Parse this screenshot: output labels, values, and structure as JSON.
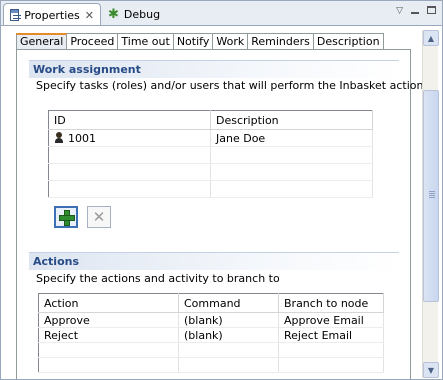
{
  "views": {
    "tabs": [
      {
        "label": "Properties",
        "active": true
      },
      {
        "label": "Debug",
        "active": false
      }
    ]
  },
  "page_tabs": [
    "General",
    "Proceed",
    "Time out",
    "Notify",
    "Work",
    "Reminders",
    "Description"
  ],
  "selected_tab": "General",
  "work_assignment": {
    "title": "Work assignment",
    "description": "Specify tasks (roles) and/or users that will perform the Inbasket action",
    "columns": [
      "ID",
      "Description"
    ],
    "rows": [
      {
        "id": "1001",
        "description": "Jane Doe",
        "icon": "user-icon"
      }
    ]
  },
  "actions": {
    "title": "Actions",
    "description": "Specify the actions and activity to branch to",
    "columns": [
      "Action",
      "Command",
      "Branch to node"
    ],
    "rows": [
      {
        "action": "Approve",
        "command": "(blank)",
        "branch": "Approve Email"
      },
      {
        "action": "Reject",
        "command": "(blank)",
        "branch": "Reject Email"
      }
    ]
  },
  "colors": {
    "section_title": "#274b86",
    "selected_tab_accent": "#e68b2c"
  }
}
